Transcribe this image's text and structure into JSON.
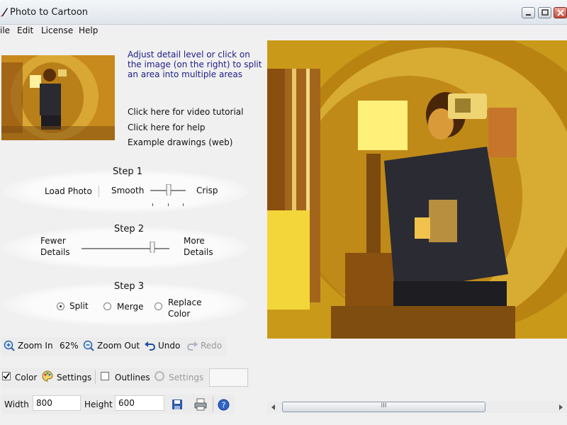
{
  "window": {
    "title": "Photo to Cartoon"
  },
  "menu": [
    "ile",
    "Edit",
    "License",
    "Help"
  ],
  "info": {
    "instructions": [
      "Adjust detail level or click on",
      "the image (on the right) to split",
      "an area into multiple areas"
    ],
    "video_tutorial": "Click here for video tutorial",
    "help": "Click here for help",
    "examples": "Example drawings (web)"
  },
  "step1": {
    "title": "Step 1",
    "load_photo": "Load Photo",
    "smooth": "Smooth",
    "crisp": "Crisp"
  },
  "step2": {
    "title": "Step 2",
    "fewer": [
      "Fewer",
      "Details"
    ],
    "more": [
      "More",
      "Details"
    ]
  },
  "step3": {
    "title": "Step 3",
    "split": "Split",
    "merge": "Merge",
    "replace": [
      "Replace",
      "Color"
    ],
    "selected": "split"
  },
  "zoombar": {
    "zoom_in": "Zoom In",
    "zoom_level": "62%",
    "zoom_out": "Zoom Out",
    "undo": "Undo",
    "redo": "Redo"
  },
  "colorbar": {
    "color": "Color",
    "color_checked": true,
    "settings": "Settings",
    "outlines": "Outlines",
    "outlines_checked": false,
    "settings2": "Settings"
  },
  "sizebar": {
    "width_label": "Width",
    "width": "800",
    "height_label": "Height",
    "height": "600"
  },
  "scrollbar": {
    "grip": "III"
  },
  "colors": {
    "link": "#20208a",
    "image_gold": "#c99a1a"
  }
}
